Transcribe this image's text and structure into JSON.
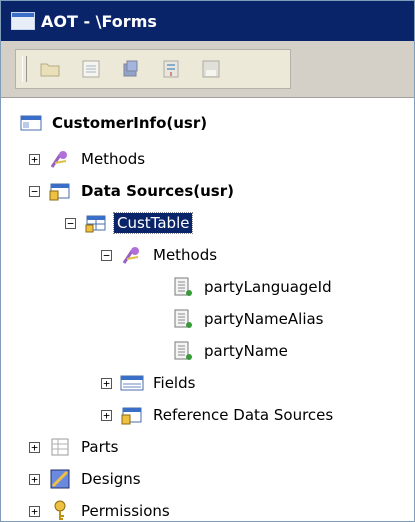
{
  "window": {
    "title": "AOT - \\Forms"
  },
  "toolbar": {
    "buttons": [
      "open-icon",
      "properties-icon",
      "compile-icon",
      "import-icon",
      "save-icon"
    ]
  },
  "tree": {
    "root": "CustomerInfo(usr)",
    "methods": "Methods",
    "data_sources": "Data Sources(usr)",
    "custtable": "CustTable",
    "custtable_methods": "Methods",
    "method_items": [
      "partyLanguageId",
      "partyNameAlias",
      "partyName"
    ],
    "fields": "Fields",
    "reference_data_sources": "Reference Data Sources",
    "parts": "Parts",
    "designs": "Designs",
    "permissions": "Permissions"
  },
  "colors": {
    "titlebar": "#0a246a",
    "selection": "#0a246a"
  }
}
